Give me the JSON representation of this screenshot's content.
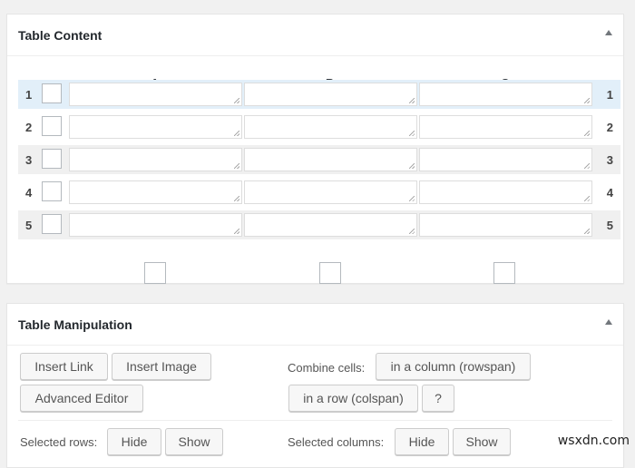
{
  "table_content": {
    "title": "Table Content",
    "columns": [
      {
        "label": "A"
      },
      {
        "label": "B"
      },
      {
        "label": "C"
      }
    ],
    "rows": [
      {
        "number": "1",
        "cells": [
          "",
          "",
          ""
        ],
        "state": "selected"
      },
      {
        "number": "2",
        "cells": [
          "",
          "",
          ""
        ],
        "state": "normal"
      },
      {
        "number": "3",
        "cells": [
          "",
          "",
          ""
        ],
        "state": "alt"
      },
      {
        "number": "4",
        "cells": [
          "",
          "",
          ""
        ],
        "state": "normal"
      },
      {
        "number": "5",
        "cells": [
          "",
          "",
          ""
        ],
        "state": "alt"
      }
    ]
  },
  "table_manipulation": {
    "title": "Table Manipulation",
    "insert_link": "Insert Link",
    "insert_image": "Insert Image",
    "advanced_editor": "Advanced Editor",
    "combine_cells_label": "Combine cells:",
    "rowspan_button": "in a column (rowspan)",
    "colspan_button": "in a row (colspan)",
    "help_button": "?",
    "selected_rows_label": "Selected rows:",
    "selected_columns_label": "Selected columns:",
    "hide": "Hide",
    "show": "Show"
  },
  "watermark": "wsxdn.com"
}
